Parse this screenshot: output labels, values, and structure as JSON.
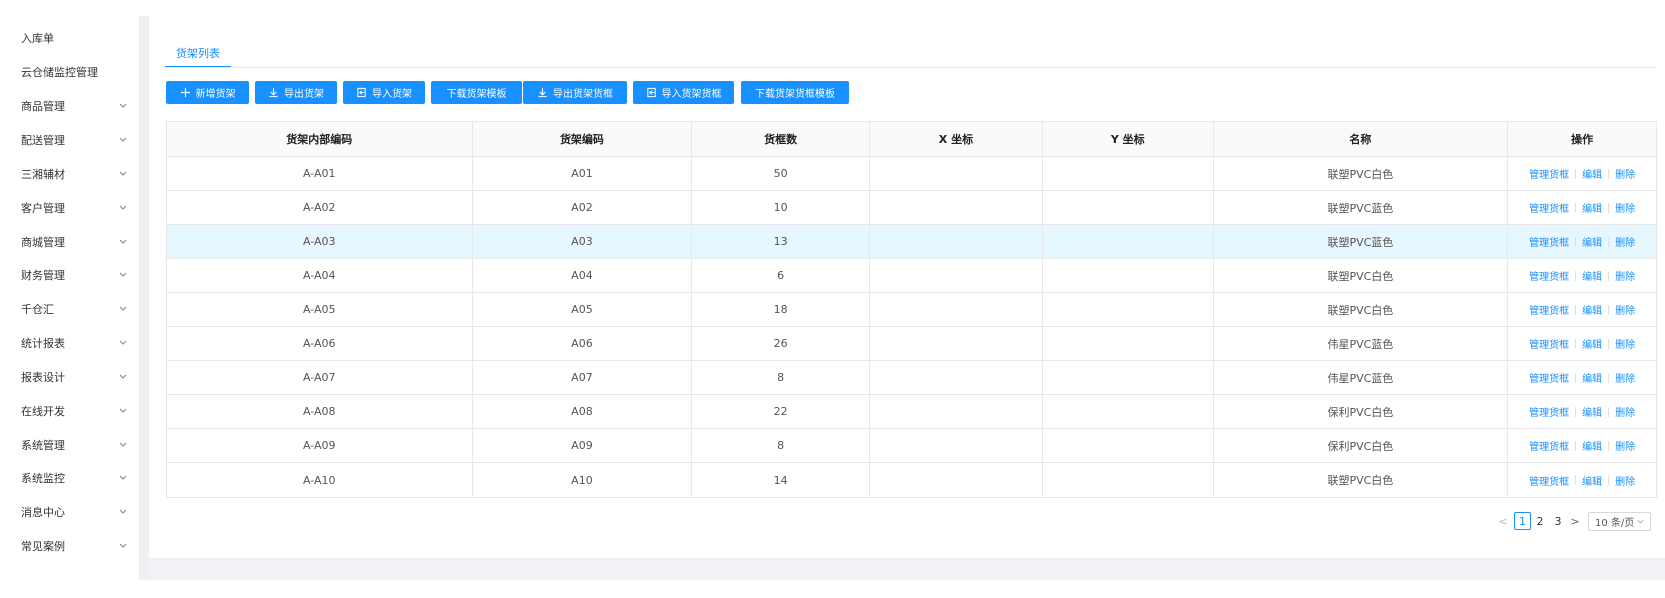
{
  "sidebar": {
    "items": [
      {
        "label": "入库单",
        "chevron": false
      },
      {
        "label": "云仓储监控管理",
        "chevron": false
      },
      {
        "label": "商品管理",
        "chevron": true
      },
      {
        "label": "配送管理",
        "chevron": true
      },
      {
        "label": "三湘辅材",
        "chevron": true
      },
      {
        "label": "客户管理",
        "chevron": true
      },
      {
        "label": "商城管理",
        "chevron": true
      },
      {
        "label": "财务管理",
        "chevron": true
      },
      {
        "label": "千仓汇",
        "chevron": true
      },
      {
        "label": "统计报表",
        "chevron": true
      },
      {
        "label": "报表设计",
        "chevron": true
      },
      {
        "label": "在线开发",
        "chevron": true
      },
      {
        "label": "系统管理",
        "chevron": true
      },
      {
        "label": "系统监控",
        "chevron": true
      },
      {
        "label": "消息中心",
        "chevron": true
      },
      {
        "label": "常见案例",
        "chevron": true
      }
    ]
  },
  "tab": {
    "label": "货架列表"
  },
  "toolbar": {
    "add": "新增货架",
    "export_shelf": "导出货架",
    "import_shelf": "导入货架",
    "download_shelf_template": "下载货架模板",
    "export_shelf_box": "导出货架货框",
    "import_shelf_box": "导入货架货框",
    "download_shelf_box_template": "下载货架货框模板"
  },
  "table": {
    "headers": [
      "货架内部编码",
      "货架编码",
      "货框数",
      "X 坐标",
      "Y 坐标",
      "名称",
      "操作"
    ],
    "rows": [
      {
        "internal_code": "A-A01",
        "code": "A01",
        "boxes": "50",
        "x": "",
        "y": "",
        "name": "联塑PVC白色"
      },
      {
        "internal_code": "A-A02",
        "code": "A02",
        "boxes": "10",
        "x": "",
        "y": "",
        "name": "联塑PVC蓝色"
      },
      {
        "internal_code": "A-A03",
        "code": "A03",
        "boxes": "13",
        "x": "",
        "y": "",
        "name": "联塑PVC蓝色"
      },
      {
        "internal_code": "A-A04",
        "code": "A04",
        "boxes": "6",
        "x": "",
        "y": "",
        "name": "联塑PVC白色"
      },
      {
        "internal_code": "A-A05",
        "code": "A05",
        "boxes": "18",
        "x": "",
        "y": "",
        "name": "联塑PVC白色"
      },
      {
        "internal_code": "A-A06",
        "code": "A06",
        "boxes": "26",
        "x": "",
        "y": "",
        "name": "伟星PVC蓝色"
      },
      {
        "internal_code": "A-A07",
        "code": "A07",
        "boxes": "8",
        "x": "",
        "y": "",
        "name": "伟星PVC蓝色"
      },
      {
        "internal_code": "A-A08",
        "code": "A08",
        "boxes": "22",
        "x": "",
        "y": "",
        "name": "保利PVC白色"
      },
      {
        "internal_code": "A-A09",
        "code": "A09",
        "boxes": "8",
        "x": "",
        "y": "",
        "name": "保利PVC白色"
      },
      {
        "internal_code": "A-A10",
        "code": "A10",
        "boxes": "14",
        "x": "",
        "y": "",
        "name": "联塑PVC白色"
      }
    ],
    "actions": {
      "manage": "管理货框",
      "edit": "编辑",
      "delete": "删除"
    },
    "highlighted_row": 2
  },
  "pagination": {
    "prev": "<",
    "pages": [
      "1",
      "2",
      "3"
    ],
    "current": "1",
    "next": ">",
    "page_size": "10 条/页"
  },
  "colors": {
    "accent": "#1890ff",
    "row_highlight": "#e6f7ff"
  }
}
